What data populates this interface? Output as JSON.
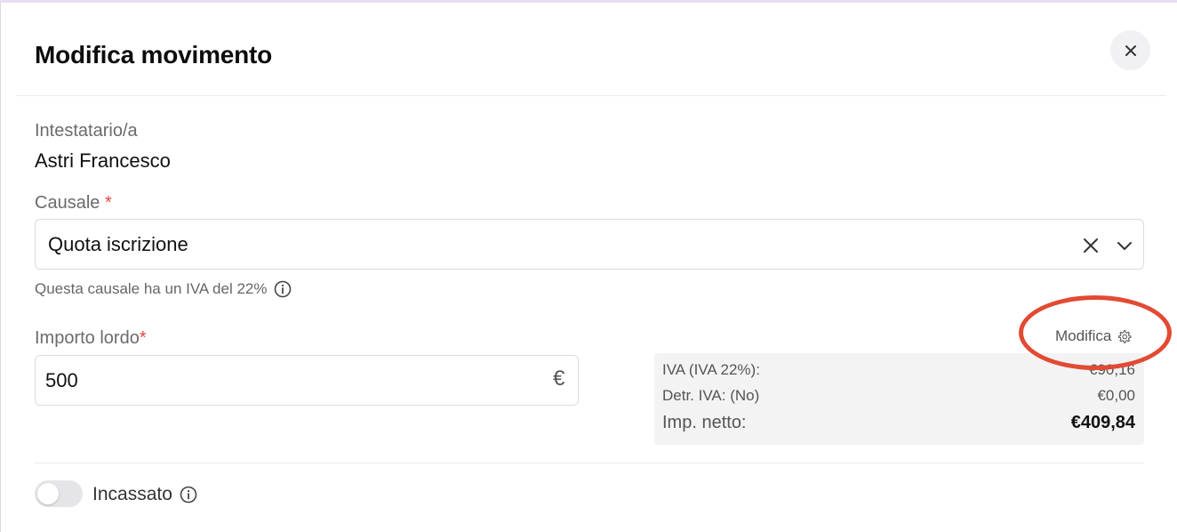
{
  "dialog": {
    "title": "Modifica movimento"
  },
  "holder": {
    "label": "Intestatario/a",
    "value": "Astri Francesco"
  },
  "causale": {
    "label": "Causale",
    "required_mark": "*",
    "selected": "Quota iscrizione",
    "hint": "Questa causale ha un IVA del 22%"
  },
  "amount": {
    "label": "Importo lordo",
    "required_mark": "*",
    "value": "500",
    "currency": "€"
  },
  "summary": {
    "edit_label": "Modifica",
    "rows": [
      {
        "label": "IVA (IVA 22%):",
        "value": "€90,16"
      },
      {
        "label": "Detr. IVA: (No)",
        "value": "€0,00"
      },
      {
        "label": "Imp. netto:",
        "value": "€409,84"
      }
    ]
  },
  "collected": {
    "label": "Incassato",
    "enabled": false
  },
  "colors": {
    "highlight": "#e24a33",
    "required": "#e8453c"
  }
}
